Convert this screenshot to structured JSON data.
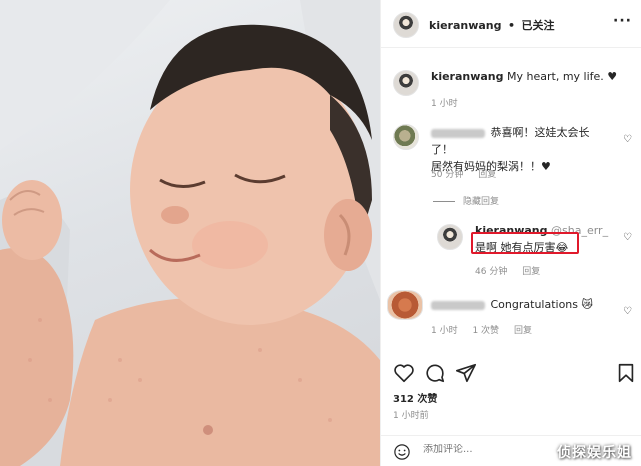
{
  "post": {
    "author": "kieranwang",
    "separator": "•",
    "follow_status": "已关注"
  },
  "caption": {
    "author": "kieranwang",
    "text": "My heart, my life. ♥",
    "time": "1 小时"
  },
  "comments": [
    {
      "text_line1": "恭喜啊！这娃太会长了！",
      "text_line2": "居然有妈妈的梨涡！！♥",
      "time": "50 分钟",
      "reply_label": "回复",
      "toggle_replies": "隐藏回复"
    },
    {
      "author": "kieranwang",
      "mention": "@sha_err_",
      "text": "是啊 她有点厉害😂",
      "time": "46 分钟",
      "reply_label": "回复"
    },
    {
      "text": "Congratulations 😿",
      "time": "1 小时",
      "likes": "1 次赞",
      "reply_label": "回复"
    }
  ],
  "actions": {
    "like_icon": "heart-outline-icon",
    "comment_icon": "comment-bubble-icon",
    "share_icon": "paper-plane-icon",
    "save_icon": "bookmark-icon"
  },
  "likes_count": "312 次赞",
  "posted_time": "1 小时前",
  "add_comment": {
    "placeholder": "添加评论..."
  },
  "watermark": "侦探娱乐姐",
  "colors": {
    "highlight_box": "#e0192b",
    "meta_text": "#8e8e8e",
    "primary_text": "#262626"
  }
}
